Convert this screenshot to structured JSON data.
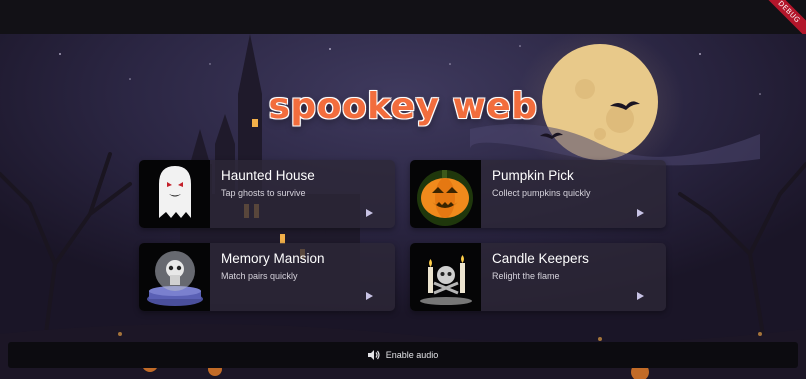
{
  "app": {
    "title": "spookey web",
    "debug_badge": "DEBUG"
  },
  "games": [
    {
      "title": "Haunted House",
      "subtitle": "Tap ghosts to survive",
      "icon": "ghost-icon"
    },
    {
      "title": "Pumpkin Pick",
      "subtitle": "Collect pumpkins quickly",
      "icon": "jack-o-lantern-icon"
    },
    {
      "title": "Memory Mansion",
      "subtitle": "Match pairs quickly",
      "icon": "skull-globe-icon"
    },
    {
      "title": "Candle Keepers",
      "subtitle": "Relight the flame",
      "icon": "candle-skull-icon"
    }
  ],
  "audio": {
    "label": "Enable audio",
    "icon": "speaker-icon"
  },
  "colors": {
    "title": "#f26d3d",
    "card_bg": "#2d2837",
    "accent": "#c9c4e6"
  }
}
